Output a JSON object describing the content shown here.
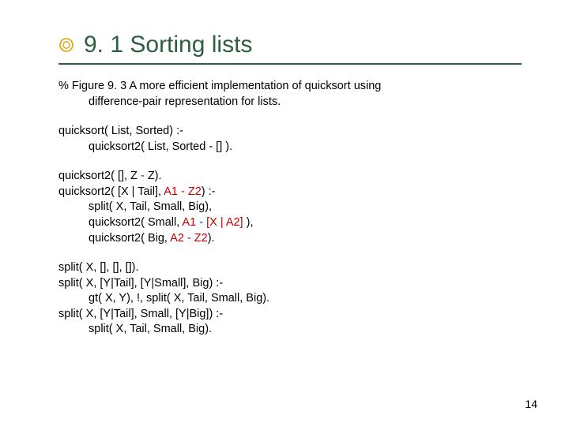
{
  "title": "9. 1 Sorting lists",
  "comment": {
    "l1": "% Figure 9. 3  A more efficient implementation of quicksort using",
    "l2": "difference-pair representation for lists."
  },
  "qs": {
    "head": "quicksort( List, Sorted)  :-",
    "body": "quicksort2( List, Sorted - [] )."
  },
  "qs2": {
    "base_a": "quicksort2( [], Z ",
    "base_b": "- ",
    "base_c": "Z).",
    "head_a": "quicksort2( [X | Tail], ",
    "head_b": "A1 - Z2",
    "head_c": ")  :-",
    "split": "split( X, Tail, Small, Big),",
    "rec1_a": "quicksort2( Small, ",
    "rec1_b": "A1 ",
    "rec1_c": "- ",
    "rec1_d": "[X | A2]",
    "rec1_e": " ),",
    "rec2_a": "quicksort2( Big, ",
    "rec2_b": "A2 - Z2",
    "rec2_c": ")."
  },
  "split": {
    "l1": "split( X, [], [], []).",
    "l2": "split( X, [Y|Tail], [Y|Small], Big)  :-",
    "l3": "gt( X, Y), !, split( X, Tail, Small, Big).",
    "l4": "split( X, [Y|Tail], Small, [Y|Big])  :-",
    "l5": "split( X, Tail, Small, Big)."
  },
  "page": "14"
}
